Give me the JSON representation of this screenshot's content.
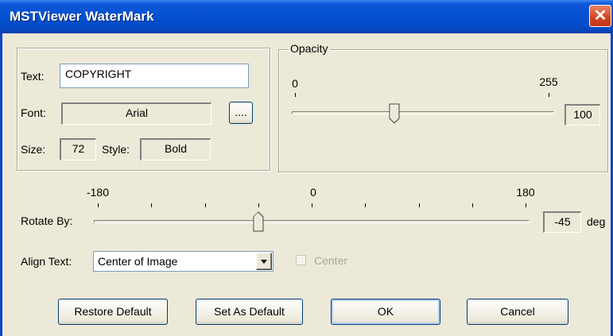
{
  "window": {
    "title": "MSTViewer WaterMark",
    "close_label": "✕"
  },
  "text_group": {
    "text_label": "Text:",
    "text_value": "COPYRIGHT",
    "font_label": "Font:",
    "font_value": "Arial",
    "font_browse_label": "....",
    "size_label": "Size:",
    "size_value": "72",
    "style_label": "Style:",
    "style_value": "Bold"
  },
  "opacity": {
    "legend": "Opacity",
    "min_label": "0",
    "max_label": "255",
    "value": "100",
    "min": 0,
    "max": 255
  },
  "rotate": {
    "label": "Rotate By:",
    "min_label": "-180",
    "mid_label": "0",
    "max_label": "180",
    "value": "-45",
    "unit": "deg",
    "min": -180,
    "max": 180
  },
  "align": {
    "label": "Align Text:",
    "selected": "Center of Image",
    "center_label": "Center",
    "center_checked": false
  },
  "buttons": {
    "restore": "Restore Default",
    "set_default": "Set As Default",
    "ok": "OK",
    "cancel": "Cancel"
  }
}
